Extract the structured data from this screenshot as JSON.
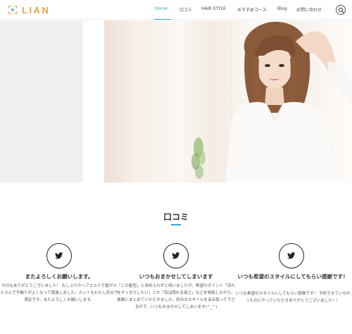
{
  "header": {
    "logo_text": "LIAN",
    "nav": [
      "Home",
      "口コミ",
      "HAIR STYLE",
      "おすすめコース",
      "Blog",
      "お問い合わせ"
    ],
    "active_index": 0,
    "accent_color": "#2fa3c9",
    "logo_color": "#e8a34b"
  },
  "hero": {
    "image": "portrait of smiling woman with wavy brown hair in white blouse"
  },
  "reviews": {
    "title": "口コミ",
    "items": [
      {
        "icon": "twitter-icon",
        "heading": "またよろしくお願いします。",
        "body": "今日もありがとうございました！ 久しぶりのヘアエステで髪がスルスルで手触りがよくなって感激しました。カットもわたし好みで満足です。またよろしくお願いします。"
      },
      {
        "icon": "twitter-icon",
        "heading": "いつもおまかせしてしまいます",
        "body": "「この髪型」と決められずに伺いましたが、希望のポイント「流れをすっきりしたい」とか「耳は隠れる長さ」などを相談しながら、素敵にまとめていただきました。好みのスタイルを汲み取って下さるので、いつもおまかせしてしまいます(^_^)"
      },
      {
        "icon": "twitter-icon",
        "heading": "いつも希望のスタイルにしてもらい感謝です！",
        "body": "いつも希望のスタイルにしてもらい感謝です！ 予約できていなかったのにやっていただきありがとうございました！！"
      }
    ]
  }
}
